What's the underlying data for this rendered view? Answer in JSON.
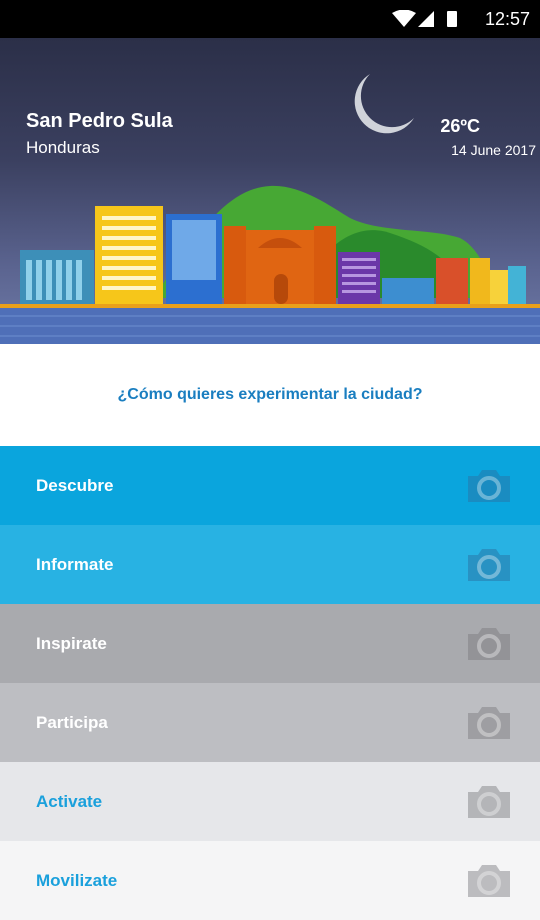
{
  "status_bar": {
    "time": "12:57"
  },
  "hero": {
    "city": "San Pedro Sula",
    "country": "Honduras",
    "temperature": "26ºC",
    "date": "14 June 2017"
  },
  "question": "¿Cómo quieres experimentar la ciudad?",
  "menu": [
    {
      "label": "Descubre",
      "bg": "#0aa5dd",
      "text": "#ffffff",
      "icon": "camera-icon"
    },
    {
      "label": "Informate",
      "bg": "#28b2e3",
      "text": "#ffffff",
      "icon": "camera-icon"
    },
    {
      "label": "Inspirate",
      "bg": "#a9aaae",
      "text": "#ffffff",
      "icon": "camera-icon"
    },
    {
      "label": "Participa",
      "bg": "#bdbec2",
      "text": "#ffffff",
      "icon": "camera-icon"
    },
    {
      "label": "Activate",
      "bg": "#e6e7ea",
      "text": "#1aa0dc",
      "icon": "camera-icon"
    },
    {
      "label": "Movilizate",
      "bg": "#f5f5f6",
      "text": "#1aa0dc",
      "icon": "camera-icon"
    }
  ]
}
